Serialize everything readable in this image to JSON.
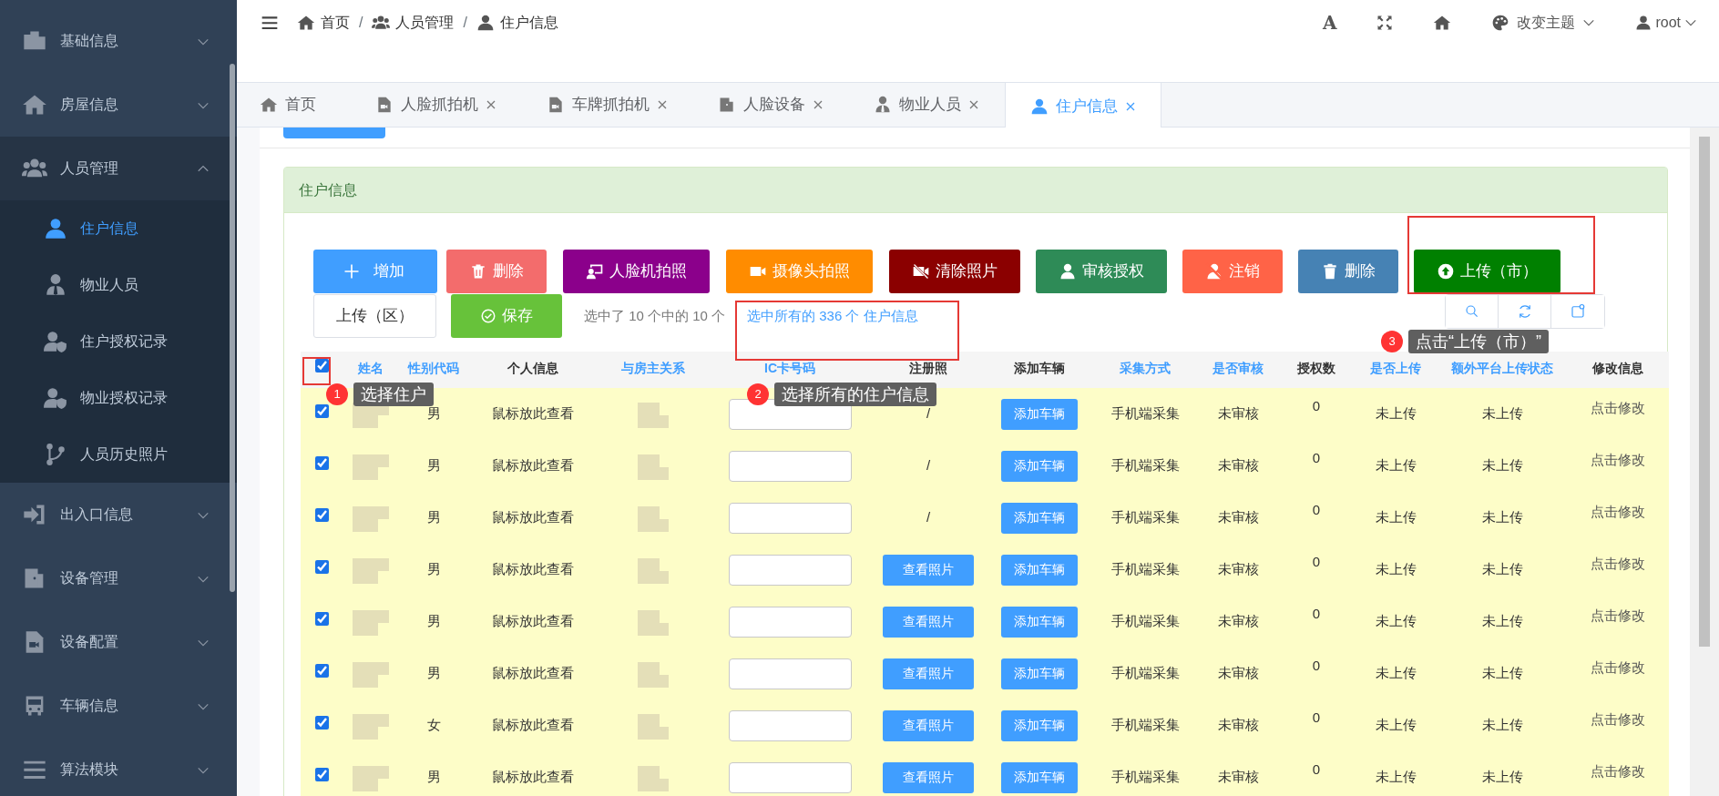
{
  "sidebar": {
    "items": [
      {
        "label": "基础信息",
        "expanded": false
      },
      {
        "label": "房屋信息",
        "expanded": false
      },
      {
        "label": "人员管理",
        "expanded": true,
        "children": [
          {
            "label": "住户信息",
            "selected": true
          },
          {
            "label": "物业人员",
            "selected": false
          },
          {
            "label": "住户授权记录",
            "selected": false
          },
          {
            "label": "物业授权记录",
            "selected": false
          },
          {
            "label": "人员历史照片",
            "selected": false
          }
        ]
      },
      {
        "label": "出入口信息",
        "expanded": false
      },
      {
        "label": "设备管理",
        "expanded": false
      },
      {
        "label": "设备配置",
        "expanded": false
      },
      {
        "label": "车辆信息",
        "expanded": false
      },
      {
        "label": "算法模块",
        "expanded": false
      }
    ]
  },
  "topbar": {
    "breadcrumb": [
      {
        "label": "首页"
      },
      {
        "separator": "/",
        "label": "人员管理"
      },
      {
        "separator": "/",
        "label": "住户信息"
      }
    ],
    "font_tool": "A",
    "theme": "改变主题",
    "user": "root"
  },
  "tabs": [
    {
      "label": "首页",
      "closable": false,
      "selected": false
    },
    {
      "label": "人脸抓拍机",
      "closable": true,
      "selected": false
    },
    {
      "label": "车牌抓拍机",
      "closable": true,
      "selected": false
    },
    {
      "label": "人脸设备",
      "closable": true,
      "selected": false
    },
    {
      "label": "物业人员",
      "closable": true,
      "selected": false
    },
    {
      "label": "住户信息",
      "closable": true,
      "selected": true
    }
  ],
  "panel": {
    "title": "住户信息",
    "toolbar": [
      {
        "label": "增加",
        "color": "#409eff"
      },
      {
        "label": "删除",
        "color": "#f36c6c"
      },
      {
        "label": "人脸机拍照",
        "color": "#8b008b"
      },
      {
        "label": "摄像头拍照",
        "color": "#ff8c00"
      },
      {
        "label": "清除照片",
        "color": "#8b0000"
      },
      {
        "label": "审核授权",
        "color": "#2e8b57"
      },
      {
        "label": "注销",
        "color": "#ff6347"
      },
      {
        "label": "删除",
        "color": "#4682b4"
      },
      {
        "label": "上传（市）",
        "color": "#008000"
      }
    ],
    "upload_district": "上传（区）",
    "save": "保存",
    "selection_text": "选中了 10 个中的 10 个",
    "select_all_link": "选中所有的 336 个 住户信息",
    "header_checked": true,
    "columns": [
      {
        "label": "姓名",
        "sortable": true
      },
      {
        "label": "性别代码",
        "sortable": true
      },
      {
        "label": "个人信息",
        "sortable": false
      },
      {
        "label": "与房主关系",
        "sortable": true
      },
      {
        "label": "IC卡号码",
        "sortable": true
      },
      {
        "label": "注册照",
        "sortable": false
      },
      {
        "label": "添加车辆",
        "sortable": false
      },
      {
        "label": "采集方式",
        "sortable": true
      },
      {
        "label": "是否审核",
        "sortable": true
      },
      {
        "label": "授权数",
        "sortable": false
      },
      {
        "label": "是否上传",
        "sortable": true
      },
      {
        "label": "额外平台上传状态",
        "sortable": true
      },
      {
        "label": "修改信息",
        "sortable": false
      }
    ],
    "rows": [
      {
        "checked": true,
        "gender": "男",
        "info": "鼠标放此查看",
        "photo": {
          "kind": "text",
          "text": "/"
        },
        "vehicle": "添加车辆",
        "method": "手机端采集",
        "audit": "未审核",
        "auth_count": "0",
        "uploaded": "未上传",
        "extra_status": "未上传",
        "edit": "点击修改"
      },
      {
        "checked": true,
        "gender": "男",
        "info": "鼠标放此查看",
        "photo": {
          "kind": "text",
          "text": "/"
        },
        "vehicle": "添加车辆",
        "method": "手机端采集",
        "audit": "未审核",
        "auth_count": "0",
        "uploaded": "未上传",
        "extra_status": "未上传",
        "edit": "点击修改"
      },
      {
        "checked": true,
        "gender": "男",
        "info": "鼠标放此查看",
        "photo": {
          "kind": "text",
          "text": "/"
        },
        "vehicle": "添加车辆",
        "method": "手机端采集",
        "audit": "未审核",
        "auth_count": "0",
        "uploaded": "未上传",
        "extra_status": "未上传",
        "edit": "点击修改"
      },
      {
        "checked": true,
        "gender": "男",
        "info": "鼠标放此查看",
        "photo": {
          "kind": "button",
          "text": "查看照片"
        },
        "vehicle": "添加车辆",
        "method": "手机端采集",
        "audit": "未审核",
        "auth_count": "0",
        "uploaded": "未上传",
        "extra_status": "未上传",
        "edit": "点击修改"
      },
      {
        "checked": true,
        "gender": "男",
        "info": "鼠标放此查看",
        "photo": {
          "kind": "button",
          "text": "查看照片"
        },
        "vehicle": "添加车辆",
        "method": "手机端采集",
        "audit": "未审核",
        "auth_count": "0",
        "uploaded": "未上传",
        "extra_status": "未上传",
        "edit": "点击修改"
      },
      {
        "checked": true,
        "gender": "男",
        "info": "鼠标放此查看",
        "photo": {
          "kind": "button",
          "text": "查看照片"
        },
        "vehicle": "添加车辆",
        "method": "手机端采集",
        "audit": "未审核",
        "auth_count": "0",
        "uploaded": "未上传",
        "extra_status": "未上传",
        "edit": "点击修改"
      },
      {
        "checked": true,
        "gender": "女",
        "info": "鼠标放此查看",
        "photo": {
          "kind": "button",
          "text": "查看照片"
        },
        "vehicle": "添加车辆",
        "method": "手机端采集",
        "audit": "未审核",
        "auth_count": "0",
        "uploaded": "未上传",
        "extra_status": "未上传",
        "edit": "点击修改"
      },
      {
        "checked": true,
        "gender": "男",
        "info": "鼠标放此查看",
        "photo": {
          "kind": "button",
          "text": "查看照片"
        },
        "vehicle": "添加车辆",
        "method": "手机端采集",
        "audit": "未审核",
        "auth_count": "0",
        "uploaded": "未上传",
        "extra_status": "未上传",
        "edit": "点击修改"
      }
    ]
  },
  "guide_steps": [
    {
      "number": "1",
      "text": "选择住户"
    },
    {
      "number": "2",
      "text": "选择所有的住户信息"
    },
    {
      "number": "3",
      "text": "点击“上传（市）”"
    }
  ]
}
